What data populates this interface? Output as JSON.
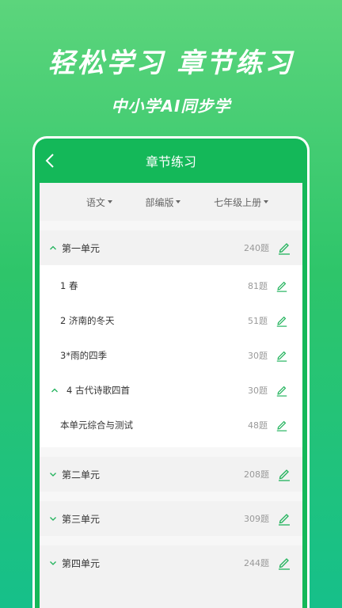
{
  "hero": {
    "title": "轻松学习 章节练习",
    "subtitle": "中小学AI同步学"
  },
  "nav": {
    "title": "章节练习"
  },
  "filters": [
    {
      "label": "语文"
    },
    {
      "label": "部编版"
    },
    {
      "label": "七年级上册"
    }
  ],
  "units": [
    {
      "title": "第一单元",
      "count": "240题",
      "expanded": true
    },
    {
      "title": "第二单元",
      "count": "208题",
      "expanded": false
    },
    {
      "title": "第三单元",
      "count": "309题",
      "expanded": false
    },
    {
      "title": "第四单元",
      "count": "244题",
      "expanded": false
    }
  ],
  "lessons": [
    {
      "title": "1 春",
      "count": "81题"
    },
    {
      "title": "2 济南的冬天",
      "count": "51题"
    },
    {
      "title": "3*雨的四季",
      "count": "30题"
    },
    {
      "title": "4 古代诗歌四首",
      "count": "30题"
    },
    {
      "title": "本单元综合与测试",
      "count": "48题"
    }
  ],
  "colors": {
    "accent": "#1fb25a",
    "nav": "#14b859"
  }
}
